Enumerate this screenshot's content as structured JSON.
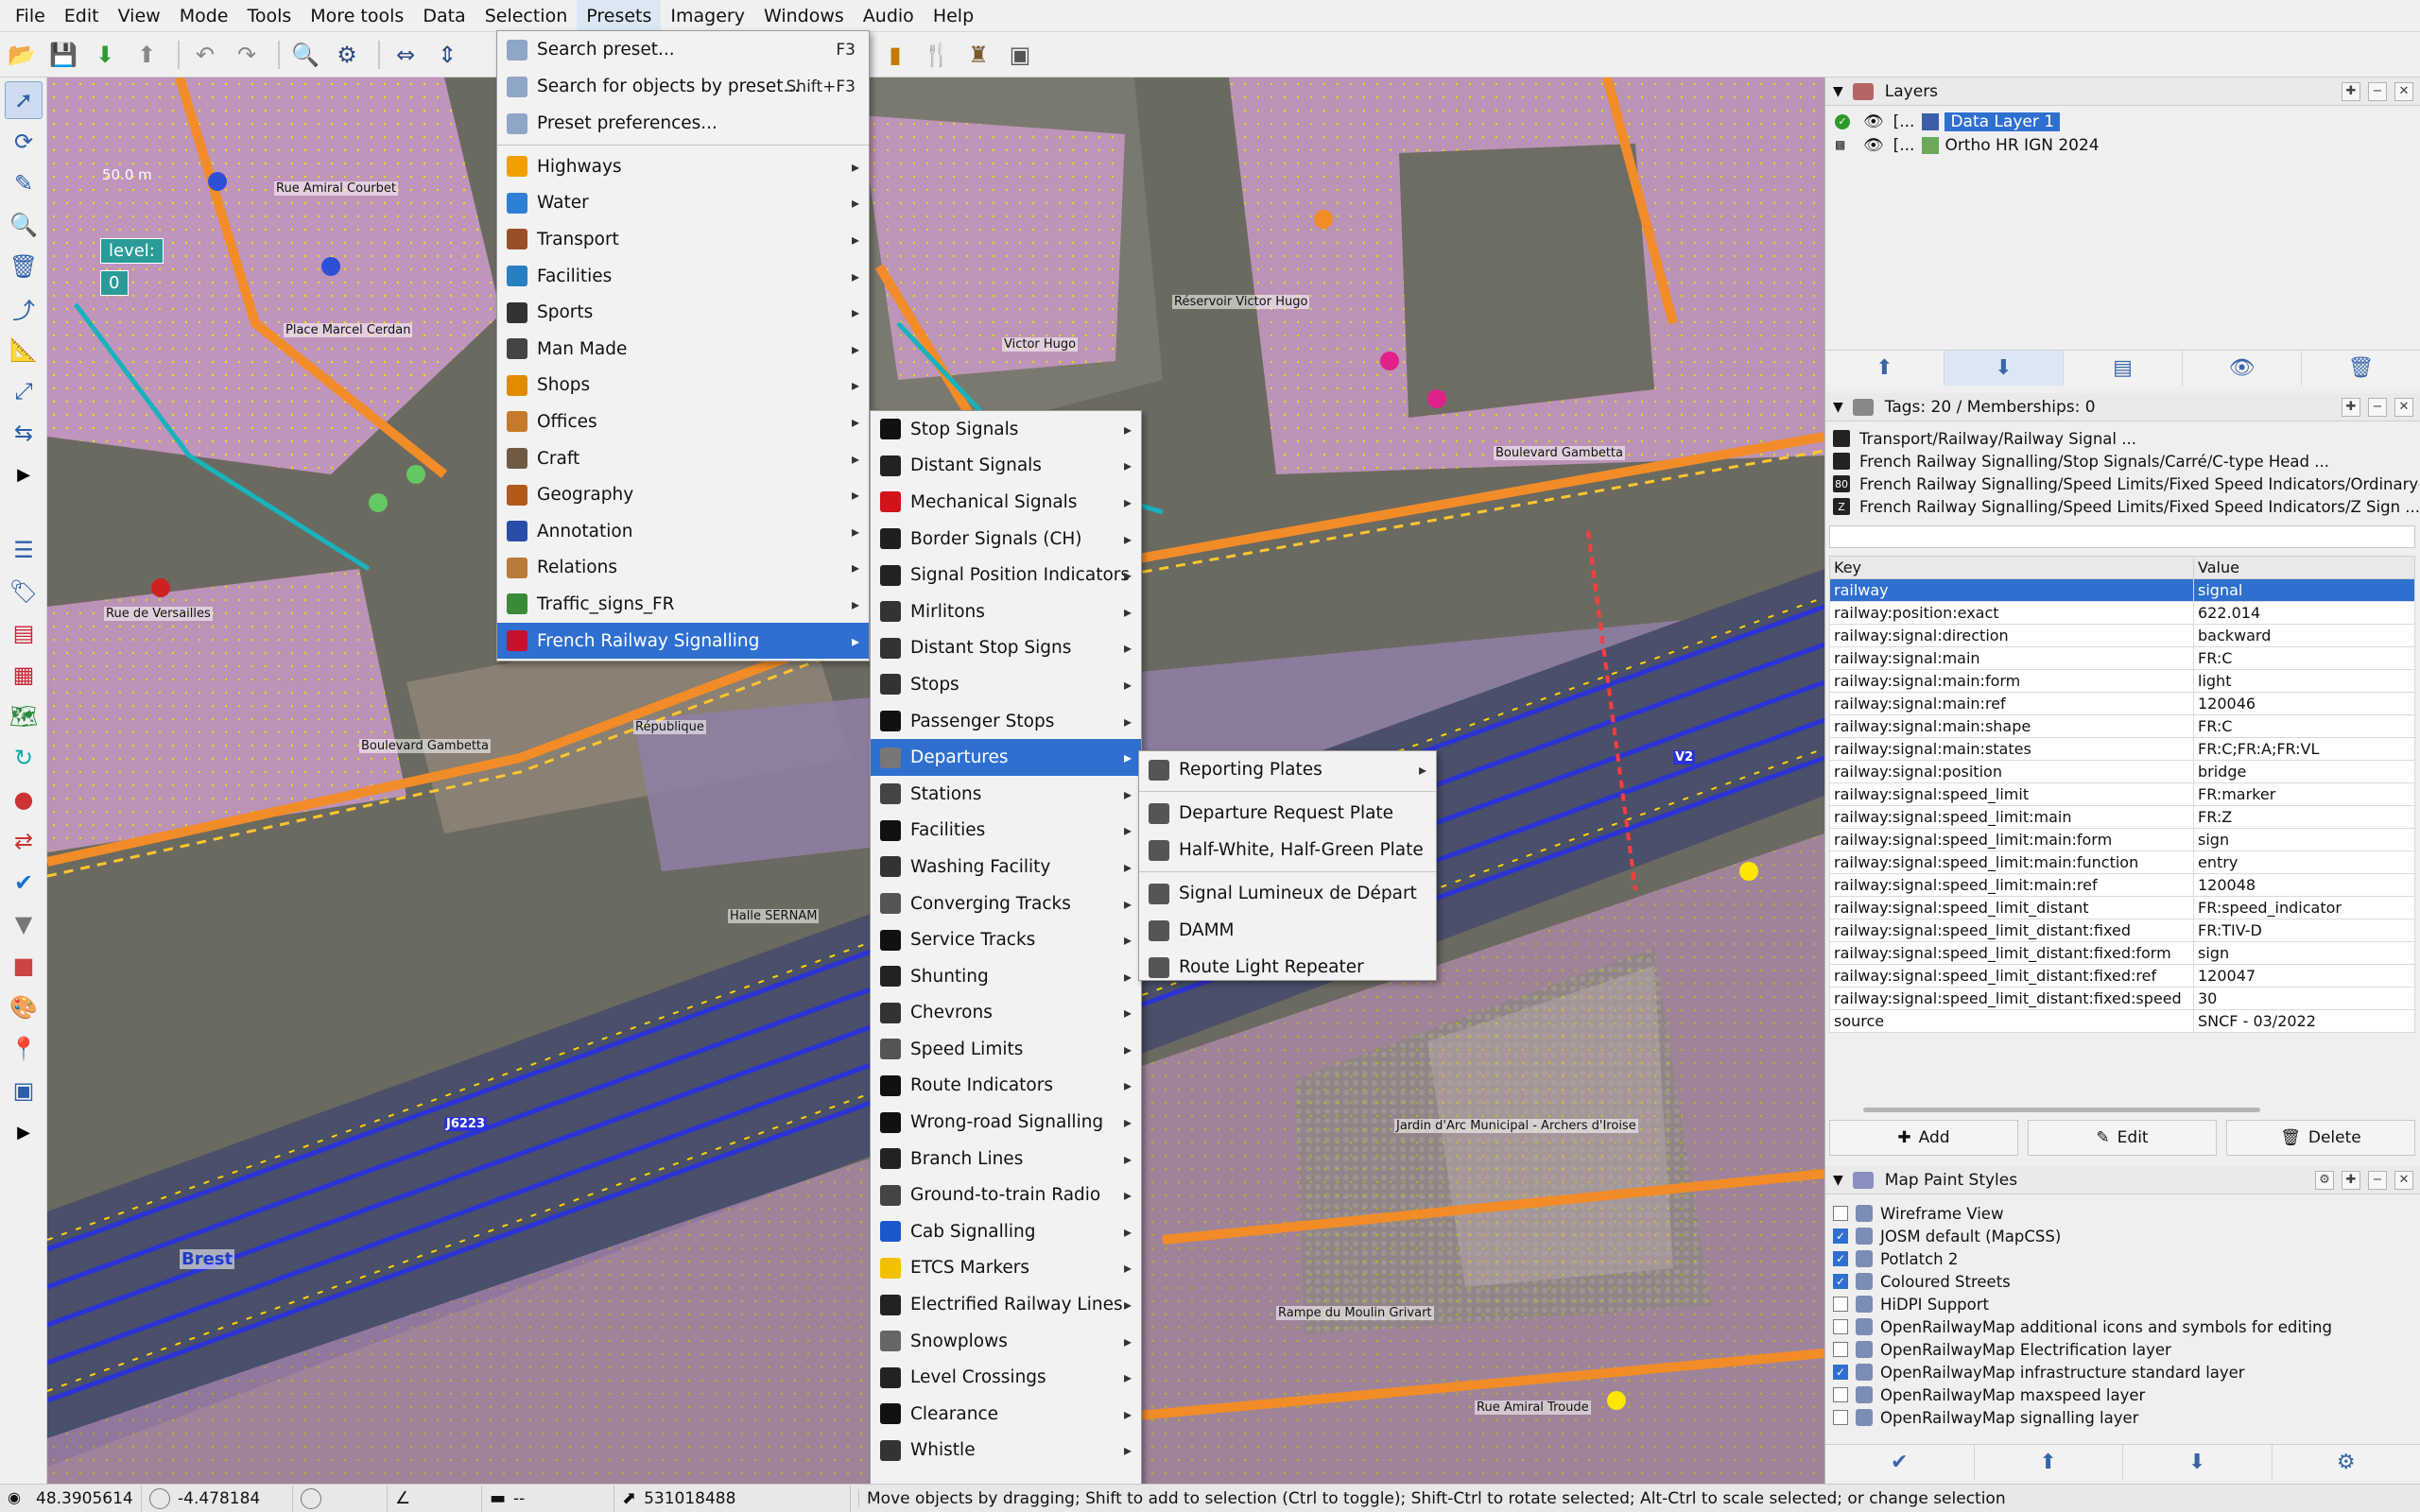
{
  "menubar": [
    "File",
    "Edit",
    "View",
    "Mode",
    "Tools",
    "More tools",
    "Data",
    "Selection",
    "Presets",
    "Imagery",
    "Windows",
    "Audio",
    "Help"
  ],
  "map": {
    "scale": "50.0 m",
    "level_label": "level:",
    "level_value": "0",
    "labels": [
      "Place Marcel Cerdan",
      "Rue Amiral Courbet",
      "Rue de Versailles",
      "Boulevard Gambetta",
      "Réservoir Victor Hugo",
      "Jardin d'Arc Municipal - Archers d'Iroise",
      "Rue Amiral Troude",
      "Rampe du Moulin Grivart",
      "Boulevard Gambetta",
      "Halle SERNAM",
      "Brest",
      "République",
      "Victor Hugo",
      "J6223",
      "V2"
    ]
  },
  "presets_menu": {
    "top": [
      {
        "label": "Search preset...",
        "acc": "F3",
        "icon": "search-icon"
      },
      {
        "label": "Search for objects by preset...",
        "acc": "Shift+F3",
        "icon": "search-objects-icon"
      },
      {
        "label": "Preset preferences...",
        "acc": "",
        "icon": "preferences-icon"
      }
    ],
    "items": [
      {
        "label": "Highways",
        "icon": "highway-icon",
        "color": "#f2a000"
      },
      {
        "label": "Water",
        "icon": "water-icon",
        "color": "#2e7fd6"
      },
      {
        "label": "Transport",
        "icon": "transport-icon",
        "color": "#9a4f2b"
      },
      {
        "label": "Facilities",
        "icon": "bed-icon",
        "color": "#2a7fc0"
      },
      {
        "label": "Sports",
        "icon": "ball-icon",
        "color": "#333333"
      },
      {
        "label": "Man Made",
        "icon": "tower-icon",
        "color": "#444444"
      },
      {
        "label": "Shops",
        "icon": "shop-icon",
        "color": "#e38b00"
      },
      {
        "label": "Offices",
        "icon": "office-icon",
        "color": "#c47a2a"
      },
      {
        "label": "Craft",
        "icon": "craft-icon",
        "color": "#6f5a45"
      },
      {
        "label": "Geography",
        "icon": "mountain-icon",
        "color": "#b05a1c"
      },
      {
        "label": "Annotation",
        "icon": "annotation-icon",
        "color": "#2a4ea8"
      },
      {
        "label": "Relations",
        "icon": "relation-icon",
        "color": "#b97a3a"
      },
      {
        "label": "Traffic_signs_FR",
        "icon": "traffic-sign-icon",
        "color": "#3b8a3a"
      },
      {
        "label": "French Railway Signalling",
        "icon": "sncf-icon",
        "color": "#c8102e"
      }
    ]
  },
  "railway_menu": [
    {
      "label": "Stop Signals",
      "color": "#111111"
    },
    {
      "label": "Distant Signals",
      "color": "#222222"
    },
    {
      "label": "Mechanical Signals",
      "color": "#d1141a"
    },
    {
      "label": "Border Signals (CH)",
      "color": "#1f1f1f"
    },
    {
      "label": "Signal Position Indicators",
      "color": "#222222"
    },
    {
      "label": "Mirlitons",
      "color": "#333333"
    },
    {
      "label": "Distant Stop Signs",
      "color": "#333333"
    },
    {
      "label": "Stops",
      "color": "#333333"
    },
    {
      "label": "Passenger Stops",
      "color": "#111111"
    },
    {
      "label": "Departures",
      "color": "#777777"
    },
    {
      "label": "Stations",
      "color": "#444444"
    },
    {
      "label": "Facilities",
      "color": "#111111"
    },
    {
      "label": "Washing Facility",
      "color": "#333333"
    },
    {
      "label": "Converging Tracks",
      "color": "#555555"
    },
    {
      "label": "Service Tracks",
      "color": "#111111"
    },
    {
      "label": "Shunting",
      "color": "#222222"
    },
    {
      "label": "Chevrons",
      "color": "#333333"
    },
    {
      "label": "Speed Limits",
      "color": "#555555"
    },
    {
      "label": "Route Indicators",
      "color": "#111111"
    },
    {
      "label": "Wrong-road Signalling",
      "color": "#111111"
    },
    {
      "label": "Branch Lines",
      "color": "#222222"
    },
    {
      "label": "Ground-to-train Radio",
      "color": "#444444"
    },
    {
      "label": "Cab Signalling",
      "color": "#1a57c9"
    },
    {
      "label": "ETCS Markers",
      "color": "#f2c200"
    },
    {
      "label": "Electrified Railway Lines",
      "color": "#222222"
    },
    {
      "label": "Snowplows",
      "color": "#666666"
    },
    {
      "label": "Level Crossings",
      "color": "#222222"
    },
    {
      "label": "Clearance",
      "color": "#111111"
    },
    {
      "label": "Whistle",
      "color": "#333333"
    }
  ],
  "departures_menu": [
    {
      "label": "Reporting Plates",
      "submenu": true
    },
    {
      "label": "Departure Request Plate",
      "submenu": false
    },
    {
      "label": "Half-White, Half-Green Plate",
      "submenu": false
    },
    {
      "label": "Signal Lumineux de Départ",
      "submenu": false
    },
    {
      "label": "DAMM",
      "submenu": false
    },
    {
      "label": "Route Light Repeater",
      "submenu": false
    }
  ],
  "layers": {
    "title": "Layers",
    "rows": [
      {
        "name": "Data Layer 1",
        "prefix": "[...",
        "selected": true
      },
      {
        "name": "Ortho HR IGN 2024",
        "prefix": "[...",
        "selected": false
      }
    ]
  },
  "tags": {
    "title": "Tags: 20 / Memberships: 0",
    "summaries": [
      "Transport/Railway/Railway Signal ...",
      "French Railway Signalling/Stop Signals/Carré/C-type Head ...",
      "French Railway Signalling/Speed Limits/Fixed Speed Indicators/Ordinary-type T",
      "French Railway Signalling/Speed Limits/Fixed Speed Indicators/Z Sign ..."
    ],
    "summary_badges": [
      "",
      "",
      "80",
      "Z"
    ],
    "col_key": "Key",
    "col_value": "Value",
    "rows": [
      {
        "k": "railway",
        "v": "signal"
      },
      {
        "k": "railway:position:exact",
        "v": "622.014"
      },
      {
        "k": "railway:signal:direction",
        "v": "backward"
      },
      {
        "k": "railway:signal:main",
        "v": "FR:C"
      },
      {
        "k": "railway:signal:main:form",
        "v": "light"
      },
      {
        "k": "railway:signal:main:ref",
        "v": "120046"
      },
      {
        "k": "railway:signal:main:shape",
        "v": "FR:C"
      },
      {
        "k": "railway:signal:main:states",
        "v": "FR:C;FR:A;FR:VL"
      },
      {
        "k": "railway:signal:position",
        "v": "bridge"
      },
      {
        "k": "railway:signal:speed_limit",
        "v": "FR:marker"
      },
      {
        "k": "railway:signal:speed_limit:main",
        "v": "FR:Z"
      },
      {
        "k": "railway:signal:speed_limit:main:form",
        "v": "sign"
      },
      {
        "k": "railway:signal:speed_limit:main:function",
        "v": "entry"
      },
      {
        "k": "railway:signal:speed_limit:main:ref",
        "v": "120048"
      },
      {
        "k": "railway:signal:speed_limit_distant",
        "v": "FR:speed_indicator"
      },
      {
        "k": "railway:signal:speed_limit_distant:fixed",
        "v": "FR:TIV-D"
      },
      {
        "k": "railway:signal:speed_limit_distant:fixed:form",
        "v": "sign"
      },
      {
        "k": "railway:signal:speed_limit_distant:fixed:ref",
        "v": "120047"
      },
      {
        "k": "railway:signal:speed_limit_distant:fixed:speed",
        "v": "30"
      },
      {
        "k": "source",
        "v": "SNCF - 03/2022"
      }
    ],
    "add": "Add",
    "edit": "Edit",
    "delete": "Delete"
  },
  "mappaint": {
    "title": "Map Paint Styles",
    "rows": [
      {
        "label": "Wireframe View",
        "checked": false,
        "icon": "wireframe-icon"
      },
      {
        "label": "JOSM default (MapCSS)",
        "checked": true,
        "icon": "josm-icon"
      },
      {
        "label": "Potlatch 2",
        "checked": true,
        "icon": "potlatch-icon"
      },
      {
        "label": "Coloured Streets",
        "checked": true,
        "icon": "streets-icon"
      },
      {
        "label": "HiDPI Support",
        "checked": false,
        "icon": "hidpi-icon"
      },
      {
        "label": "OpenRailwayMap additional icons and symbols for editing",
        "checked": false,
        "icon": "orm-icon"
      },
      {
        "label": "OpenRailwayMap Electrification layer",
        "checked": false,
        "icon": "orm-icon"
      },
      {
        "label": "OpenRailwayMap infrastructure standard layer",
        "checked": true,
        "icon": "orm-icon"
      },
      {
        "label": "OpenRailwayMap maxspeed layer",
        "checked": false,
        "icon": "orm-icon"
      },
      {
        "label": "OpenRailwayMap signalling layer",
        "checked": false,
        "icon": "orm-icon"
      }
    ]
  },
  "status": {
    "lat": "48.3905614",
    "lon": "-4.478184",
    "angle": "",
    "heading": "",
    "distance": "--",
    "id": "531018488",
    "message": "Move objects by dragging; Shift to add to selection (Ctrl to toggle); Shift-Ctrl to rotate selected; Alt-Ctrl to scale selected; or change selection"
  },
  "colors": {
    "accent": "#2f6fd0",
    "menubg": "#f2f2f2",
    "roofs": "#d9a8d4",
    "roads": "#f28c28"
  }
}
